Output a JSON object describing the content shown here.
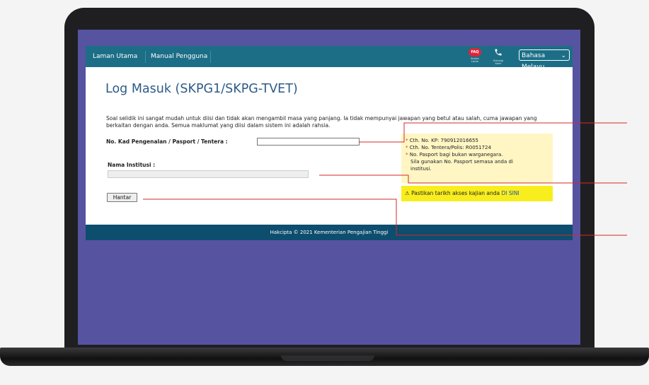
{
  "nav": {
    "home": "Laman Utama",
    "manual": "Manual Pengguna",
    "faq_badge": "FAQ",
    "faq_label": "Soalan Lazim",
    "contact_label": "Hubungi Kami",
    "language": "Bahasa Melayu",
    "caret": "⌄"
  },
  "page": {
    "title": "Log Masuk (SKPG1/SKPG-TVET)",
    "intro": "Soal selidik ini sangat mudah untuk diisi dan tidak akan mengambil masa yang panjang. Ia tidak mempunyai jawapan yang betul atau salah, cuma jawapan yang berkaitan dengan anda. Semua maklumat yang diisi dalam sistem ini adalah rahsia."
  },
  "form": {
    "ic_label": "No. Kad Pengenalan / Pasport / Tentera :",
    "ic_value": "",
    "institution_label": "Nama Institusi :",
    "institution_value": "",
    "submit": "Hantar"
  },
  "hints": {
    "star": "*",
    "line1": "Cth. No. KP: 790912016655",
    "line2": "Cth. No. Tentera/Polis: R0051724",
    "line3": "No. Pasport bagi bukan warganegara.",
    "line4": "Sila gunakan No. Pasport semasa anda di",
    "line5": "institusi."
  },
  "warning": {
    "icon": "⚠",
    "text": "Pastikan tarikh akses kajian anda",
    "link": "DI SINI"
  },
  "footer": {
    "text": "Hakcipta © 2021 Kementerian Pengajian Tinggi"
  },
  "colors": {
    "screen_bg": "#5653a0",
    "navbar": "#1c6e86",
    "footer": "#0d4d6e",
    "title": "#2d5b88",
    "callout": "#d62828",
    "hint_bg": "#fff6c4",
    "warning_bg": "#f8ee1e"
  }
}
